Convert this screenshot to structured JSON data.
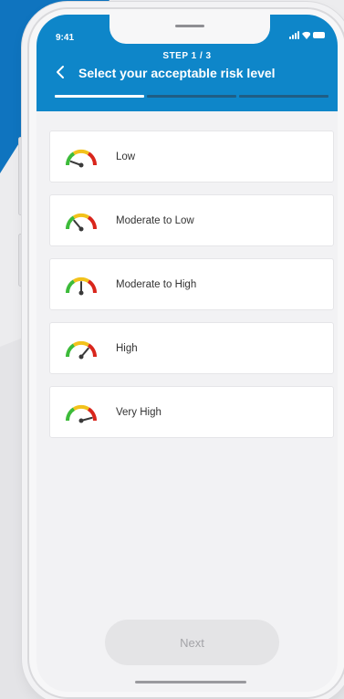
{
  "status_bar": {
    "time": "9:41"
  },
  "header": {
    "step": "STEP 1 / 3",
    "title": "Select your acceptable risk level",
    "progress": {
      "current_step": 1,
      "total_steps": 3
    }
  },
  "risk_levels": [
    {
      "label": "Low",
      "icon": "gauge-low-icon"
    },
    {
      "label": "Moderate to Low",
      "icon": "gauge-moderate-low-icon"
    },
    {
      "label": "Moderate to High",
      "icon": "gauge-moderate-high-icon"
    },
    {
      "label": "High",
      "icon": "gauge-high-icon"
    },
    {
      "label": "Very High",
      "icon": "gauge-very-high-icon"
    }
  ],
  "footer": {
    "next_label": "Next"
  },
  "colors": {
    "header": "#0e86c9",
    "progress_done": "#ffffff",
    "progress_todo": "#1f5e85",
    "gauge_green": "#3dbb3a",
    "gauge_yellow": "#f2c21b",
    "gauge_red": "#d9261c",
    "button_disabled": "#e4e4e6"
  }
}
